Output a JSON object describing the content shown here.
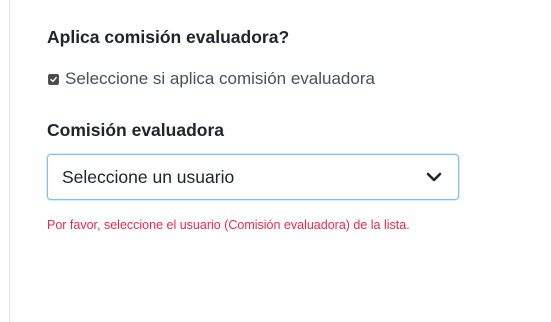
{
  "form": {
    "applies_title": "Aplica comisión evaluadora?",
    "applies_checkbox_label": "Seleccione si aplica comisión evaluadora",
    "applies_checked": true,
    "committee_title": "Comisión evaluadora",
    "committee_select_value": "Seleccione un usuario",
    "committee_error": "Por favor, seleccione el usuario (Comisión evaluadora) de la lista."
  },
  "icons": {
    "checkbox": "check-icon",
    "select": "chevron-down-icon"
  },
  "colors": {
    "error": "#f0284a",
    "focus_border": "#80bdff"
  }
}
